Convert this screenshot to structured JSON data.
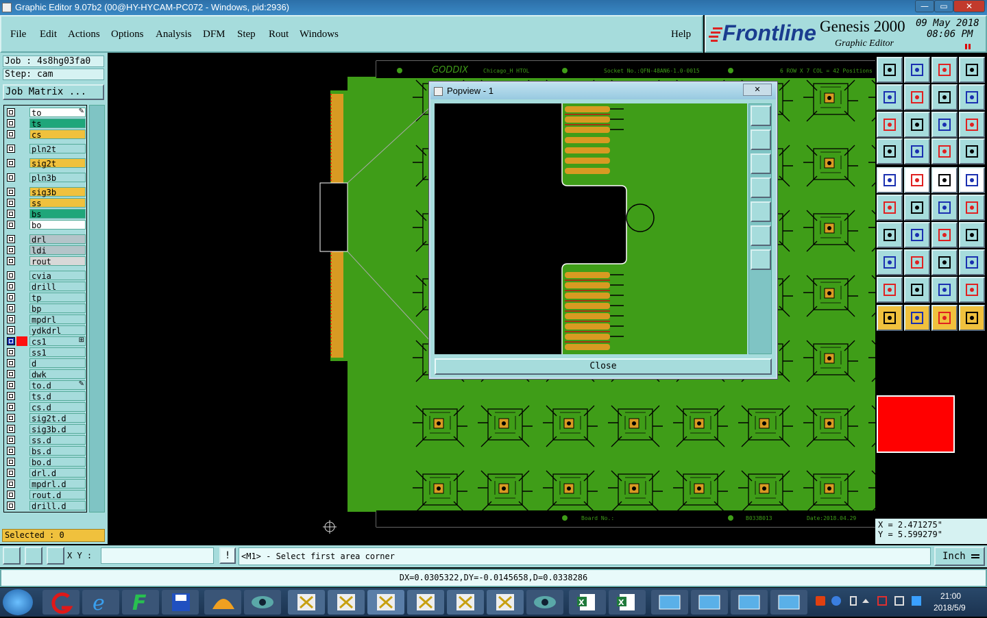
{
  "window": {
    "title": "Graphic Editor 9.07b2 (00@HY-HYCAM-PC072 - Windows, pid:2936)",
    "min": "—",
    "max": "▭",
    "close": "✕"
  },
  "menu": [
    "File",
    "Edit",
    "Actions",
    "Options",
    "Analysis",
    "DFM",
    "Step",
    "Rout",
    "Windows"
  ],
  "help": "Help",
  "brand": {
    "logo": "Frontline",
    "product": "Genesis 2000",
    "subtitle": "Graphic Editor",
    "date": "09 May 2018",
    "time": "08:06 PM"
  },
  "job": {
    "job_label": "Job : 4s8hg03fa0",
    "step_label": "Step: cam",
    "matrix_button": "Job Matrix ..."
  },
  "layers": [
    {
      "name": "to",
      "color": "#ffffff",
      "mark": "✎"
    },
    {
      "name": "ts",
      "color": "#1fa67a"
    },
    {
      "name": "cs",
      "color": "#f0c13d"
    },
    {
      "name": "pln2t",
      "color": "#a6dcdc"
    },
    {
      "name": "sig2t",
      "color": "#f0c13d"
    },
    {
      "name": "pln3b",
      "color": "#a6dcdc"
    },
    {
      "name": "sig3b",
      "color": "#f0c13d"
    },
    {
      "name": "ss",
      "color": "#f0c13d"
    },
    {
      "name": "bs",
      "color": "#1fa67a"
    },
    {
      "name": "bo",
      "color": "#ffffff"
    },
    {
      "name": "drl",
      "color": "#b4c4c9"
    },
    {
      "name": "ldi",
      "color": "#b4c4c9"
    },
    {
      "name": "rout",
      "color": "#d8d8d8"
    },
    {
      "name": "cvia",
      "color": "#a6dcdc"
    },
    {
      "name": "drill",
      "color": "#a6dcdc"
    },
    {
      "name": "tp",
      "color": "#a6dcdc"
    },
    {
      "name": "bp",
      "color": "#a6dcdc"
    },
    {
      "name": "mpdrl",
      "color": "#a6dcdc"
    },
    {
      "name": "ydkdrl",
      "color": "#a6dcdc"
    },
    {
      "name": "cs1",
      "color": "#a6dcdc",
      "active": true,
      "mark": "⊞"
    },
    {
      "name": "ss1",
      "color": "#a6dcdc"
    },
    {
      "name": "d",
      "color": "#a6dcdc"
    },
    {
      "name": "dwk",
      "color": "#a6dcdc"
    },
    {
      "name": "to.d",
      "color": "#a6dcdc",
      "mark": "✎"
    },
    {
      "name": "ts.d",
      "color": "#a6dcdc"
    },
    {
      "name": "cs.d",
      "color": "#a6dcdc"
    },
    {
      "name": "sig2t.d",
      "color": "#a6dcdc"
    },
    {
      "name": "sig3b.d",
      "color": "#a6dcdc"
    },
    {
      "name": "ss.d",
      "color": "#a6dcdc"
    },
    {
      "name": "bs.d",
      "color": "#a6dcdc"
    },
    {
      "name": "bo.d",
      "color": "#a6dcdc"
    },
    {
      "name": "drl.d",
      "color": "#a6dcdc"
    },
    {
      "name": "mpdrl.d",
      "color": "#a6dcdc"
    },
    {
      "name": "rout.d",
      "color": "#a6dcdc"
    },
    {
      "name": "drill.d",
      "color": "#a6dcdc"
    }
  ],
  "selected": "Selected : 0",
  "board": {
    "logo": "GODDIX",
    "name": "Chicago_H HTOL",
    "socket": "Socket No.:QFN-48AN6-1.0-0015",
    "grid": "6 ROW X 7 COL = 42 Positions",
    "board_no": "Board No.:",
    "code": "B033B013",
    "date": "Date:2018.04.29"
  },
  "popview": {
    "title": "Popview - 1",
    "close": "Close",
    "close_x": "✕"
  },
  "coords": {
    "x": "X = 2.471275\"",
    "y": "Y = 5.599279\""
  },
  "cmd": {
    "xy_label": "X Y :",
    "xy_value": "",
    "warn": "!",
    "prompt": "<M1> - Select first area corner",
    "unit": "Inch"
  },
  "status": "DX=0.0305322,DY=-0.0145658,D=0.0338286",
  "tray": {
    "time": "21:00",
    "date": "2018/5/9"
  },
  "colors": {
    "panel": "#a6dcdc",
    "board": "#3f9d18",
    "copper": "#d89a22",
    "highlight": "#ff0000"
  }
}
